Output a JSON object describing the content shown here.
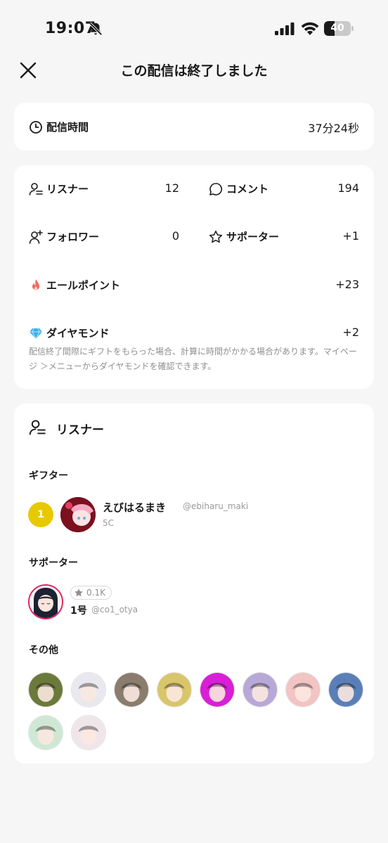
{
  "status_bar": {
    "time": "19:07",
    "battery": "40",
    "battery_level": 0.4
  },
  "header": {
    "title": "この配信は終了しました"
  },
  "duration": {
    "label": "配信時間",
    "value": "37分24秒"
  },
  "stats": {
    "listeners": {
      "label": "リスナー",
      "value": "12"
    },
    "comments": {
      "label": "コメント",
      "value": "194"
    },
    "followers": {
      "label": "フォロワー",
      "value": "0"
    },
    "supporters": {
      "label": "サポーター",
      "value": "+1"
    },
    "yell_points": {
      "label": "エールポイント",
      "value": "+23"
    },
    "diamonds": {
      "label": "ダイヤモンド",
      "value": "+2"
    },
    "note": "配信終了間際にギフトをもらった場合、計算に時間がかかる場合があります。マイページ ＞メニューからダイヤモンドを確認できます。"
  },
  "listeners_section": {
    "title": "リスナー",
    "gifters": {
      "title": "ギフター",
      "items": [
        {
          "rank": "1",
          "name": "えびはるまき",
          "handle": "@ebiharu_maki",
          "amount": "5C"
        }
      ]
    },
    "supporters": {
      "title": "サポーター",
      "items": [
        {
          "badge": "0.1K",
          "name": "1号",
          "handle": "@co1_otya"
        }
      ]
    },
    "others": {
      "title": "その他",
      "avatars": [
        {
          "name": "avatar-1",
          "color": "#6b7a3a"
        },
        {
          "name": "avatar-2",
          "color": "#e8e8ee"
        },
        {
          "name": "avatar-3",
          "color": "#8a7d6e"
        },
        {
          "name": "avatar-4",
          "color": "#d9c56a"
        },
        {
          "name": "avatar-5",
          "color": "#d81fd6"
        },
        {
          "name": "avatar-6",
          "color": "#b8a8d8"
        },
        {
          "name": "avatar-7",
          "color": "#f2c4c4"
        },
        {
          "name": "avatar-8",
          "color": "#5a7fb8"
        },
        {
          "name": "avatar-9",
          "color": "#cfe8d4"
        },
        {
          "name": "avatar-10",
          "color": "#f0e6ea"
        }
      ]
    }
  },
  "colors": {
    "rank_gold": "#e8c900",
    "fire": "#f26b5b",
    "diamond": "#3ab0e8",
    "supporter_ring": "#e0245e"
  }
}
